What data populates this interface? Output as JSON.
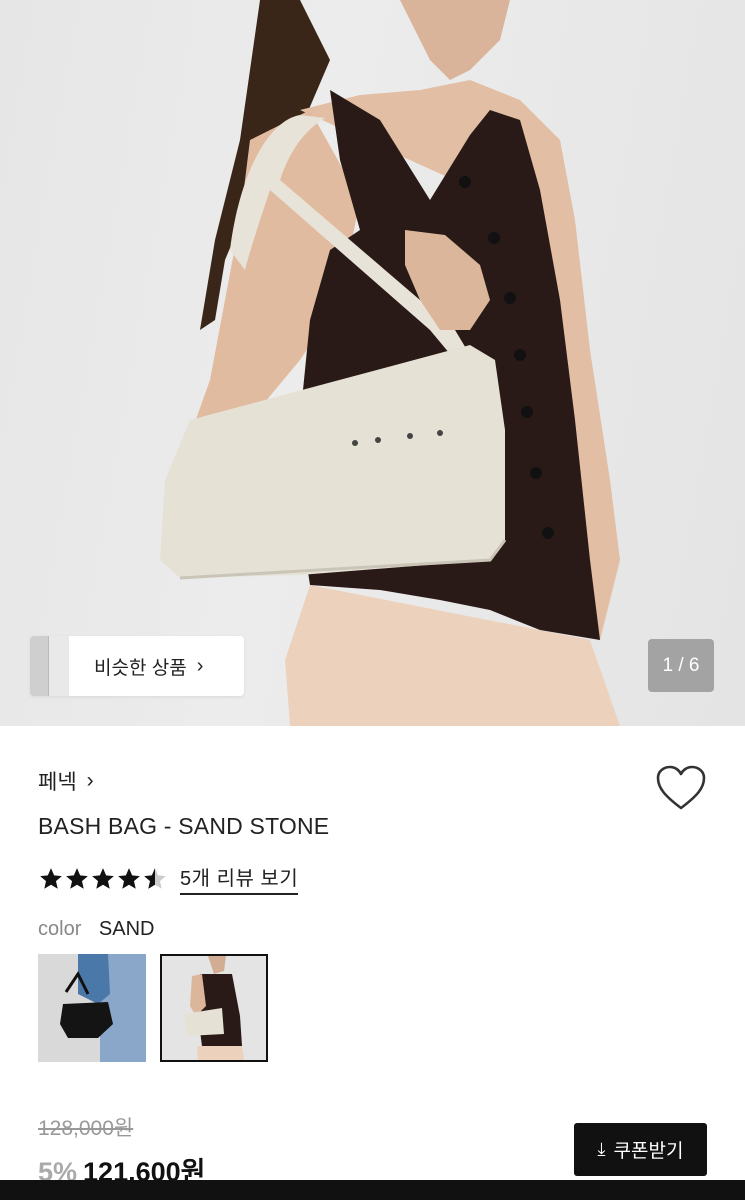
{
  "hero": {
    "similar_label": "비슷한 상품",
    "chevron": "›",
    "page_indicator": "1 / 6"
  },
  "product": {
    "brand": "페넥",
    "brand_chevron": "›",
    "title": "BASH BAG - SAND STONE",
    "rating": 4.5,
    "review_link": "5개 리뷰 보기",
    "color_label": "color",
    "color_value": "SAND",
    "swatches": [
      {
        "name": "black",
        "selected": false
      },
      {
        "name": "sand",
        "selected": true
      }
    ],
    "original_price": "128,000원",
    "discount": "5%",
    "price": "121,600원",
    "coupon_label": "쿠폰받기",
    "coupon_icon": "download-icon"
  },
  "colors": {
    "accent": "#111111",
    "muted": "#999999"
  }
}
